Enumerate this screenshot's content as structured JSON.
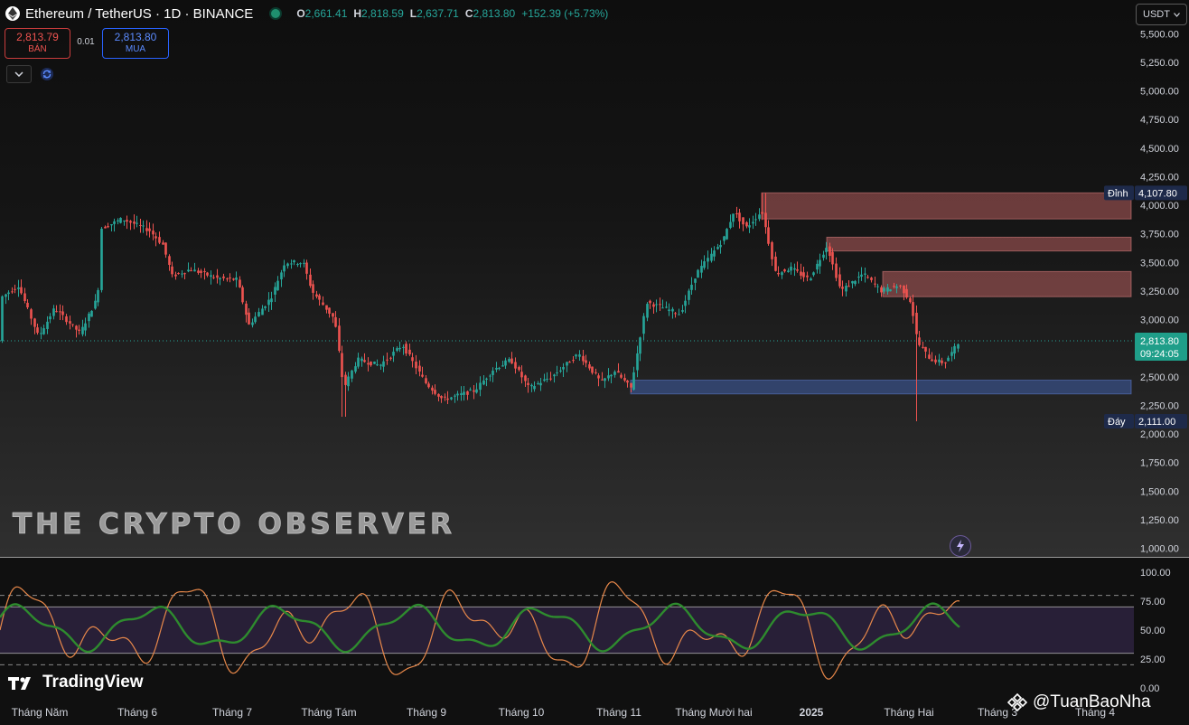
{
  "header": {
    "symbol": "Ethereum / TetherUS · 1D · BINANCE",
    "o_label": "O",
    "o_value": "2,661.41",
    "h_label": "H",
    "h_value": "2,818.59",
    "l_label": "L",
    "l_value": "2,637.71",
    "c_label": "C",
    "c_value": "2,813.80",
    "change": "+152.39 (+5.73%)"
  },
  "trade": {
    "sell_price": "2,813.79",
    "sell_label": "BÁN",
    "spread": "0.01",
    "buy_price": "2,813.80",
    "buy_label": "MUA"
  },
  "currency_selector": "USDT",
  "watermark": "THE CRYPTO OBSERVER",
  "brand": "TradingView",
  "creator": "@TuanBaoNha",
  "colors": {
    "up": "#26a69a",
    "down": "#ef5350",
    "accent": "#2962ff",
    "supply_zone": "#e57373",
    "demand_zone": "#3f5ea8"
  },
  "price_axis": {
    "ticks": [
      "5,500.00",
      "5,250.00",
      "5,000.00",
      "4,750.00",
      "4,500.00",
      "4,250.00",
      "4,000.00",
      "3,750.00",
      "3,500.00",
      "3,250.00",
      "3,000.00",
      "2,750.00",
      "2,500.00",
      "2,250.00",
      "2,000.00",
      "1,750.00",
      "1,500.00",
      "1,250.00",
      "1,000.00"
    ],
    "current_price": "2,813.80",
    "countdown": "09:24:05",
    "high_label": "Đỉnh",
    "high_value": "4,107.80",
    "low_label": "Đáy",
    "low_value": "2,111.00"
  },
  "osc_axis": {
    "ticks": [
      "100.00",
      "75.00",
      "50.00",
      "25.00",
      "0.00"
    ]
  },
  "time_axis": [
    "Tháng Năm",
    "Tháng 6",
    "Tháng 7",
    "Tháng Tám",
    "Tháng 9",
    "Tháng 10",
    "Tháng 11",
    "Tháng Mười hai",
    "2025",
    "Tháng Hai",
    "Tháng 3",
    "Tháng 4"
  ],
  "chart_data": {
    "type": "candlestick",
    "symbol": "ETH/USDT",
    "interval": "1D",
    "ylim": [
      1000,
      5500
    ],
    "anchors": [
      {
        "x": 0,
        "p": 3190
      },
      {
        "x": 20,
        "p": 3300
      },
      {
        "x": 42,
        "p": 2850
      },
      {
        "x": 60,
        "p": 3100
      },
      {
        "x": 88,
        "p": 2880
      },
      {
        "x": 108,
        "p": 3200
      },
      {
        "x": 112,
        "p": 3800
      },
      {
        "x": 135,
        "p": 3880
      },
      {
        "x": 165,
        "p": 3780
      },
      {
        "x": 180,
        "p": 3650
      },
      {
        "x": 190,
        "p": 3380
      },
      {
        "x": 210,
        "p": 3440
      },
      {
        "x": 240,
        "p": 3360
      },
      {
        "x": 262,
        "p": 3350
      },
      {
        "x": 275,
        "p": 2950
      },
      {
        "x": 300,
        "p": 3200
      },
      {
        "x": 315,
        "p": 3500
      },
      {
        "x": 335,
        "p": 3500
      },
      {
        "x": 345,
        "p": 3250
      },
      {
        "x": 370,
        "p": 3000
      },
      {
        "x": 380,
        "p": 2400
      },
      {
        "x": 395,
        "p": 2650
      },
      {
        "x": 420,
        "p": 2600
      },
      {
        "x": 445,
        "p": 2780
      },
      {
        "x": 470,
        "p": 2450
      },
      {
        "x": 490,
        "p": 2300
      },
      {
        "x": 525,
        "p": 2380
      },
      {
        "x": 545,
        "p": 2560
      },
      {
        "x": 565,
        "p": 2650
      },
      {
        "x": 585,
        "p": 2400
      },
      {
        "x": 610,
        "p": 2500
      },
      {
        "x": 640,
        "p": 2700
      },
      {
        "x": 665,
        "p": 2450
      },
      {
        "x": 680,
        "p": 2550
      },
      {
        "x": 698,
        "p": 2400
      },
      {
        "x": 715,
        "p": 3150
      },
      {
        "x": 735,
        "p": 3100
      },
      {
        "x": 752,
        "p": 3050
      },
      {
        "x": 770,
        "p": 3400
      },
      {
        "x": 800,
        "p": 3700
      },
      {
        "x": 812,
        "p": 3950
      },
      {
        "x": 825,
        "p": 3800
      },
      {
        "x": 843,
        "p": 3950
      },
      {
        "x": 858,
        "p": 3400
      },
      {
        "x": 875,
        "p": 3450
      },
      {
        "x": 895,
        "p": 3350
      },
      {
        "x": 915,
        "p": 3650
      },
      {
        "x": 930,
        "p": 3250
      },
      {
        "x": 955,
        "p": 3400
      },
      {
        "x": 975,
        "p": 3250
      },
      {
        "x": 995,
        "p": 3300
      },
      {
        "x": 1008,
        "p": 3150
      },
      {
        "x": 1015,
        "p": 2800
      },
      {
        "x": 1030,
        "p": 2650
      },
      {
        "x": 1045,
        "p": 2620
      },
      {
        "x": 1062,
        "p": 2813.8
      }
    ],
    "zones": [
      {
        "type": "supply",
        "from_x": 843,
        "top": 4107.8,
        "bottom": 3880
      },
      {
        "type": "supply",
        "from_x": 915,
        "top": 3720,
        "bottom": 3600
      },
      {
        "type": "supply",
        "from_x": 977,
        "top": 3420,
        "bottom": 3200
      },
      {
        "type": "demand",
        "from_x": 698,
        "top": 2470,
        "bottom": 2350
      }
    ],
    "oscillator": {
      "type": "stoch_rsi",
      "ylim": [
        0,
        100
      ],
      "bands": [
        20,
        80
      ],
      "inner_band": [
        30,
        70
      ]
    }
  }
}
